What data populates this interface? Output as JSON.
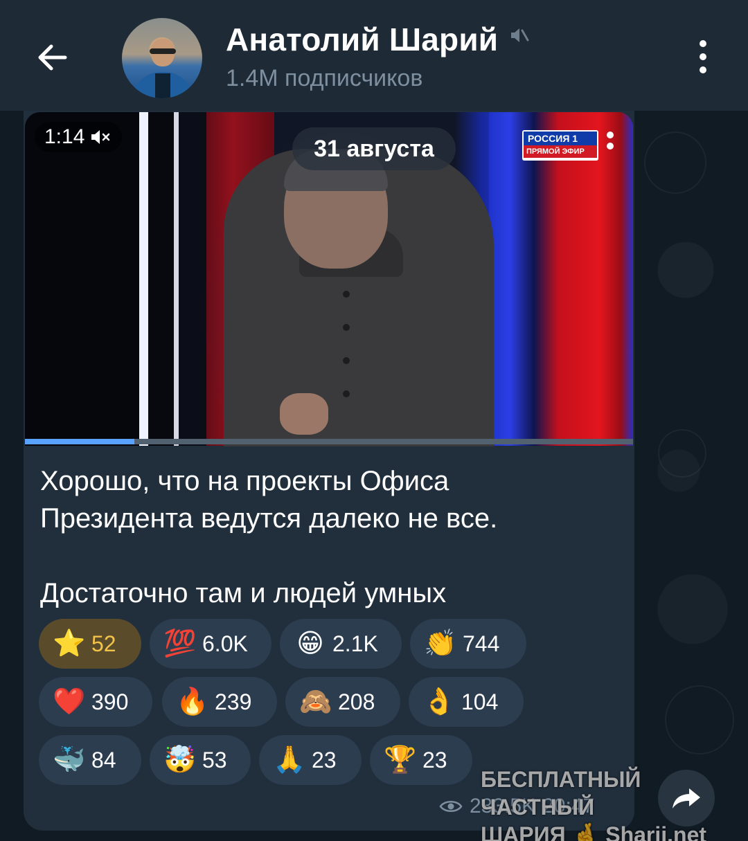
{
  "header": {
    "back_icon": "arrow-left-icon",
    "channel_title": "Анатолий Шарий",
    "muted_icon": "muted-speaker-icon",
    "subscribers": "1.4M подписчиков",
    "menu_icon": "vertical-dots-icon"
  },
  "video": {
    "duration": "1:14",
    "sound_icon": "speaker-muted-icon",
    "date_label": "31 августа",
    "tv_logo_top": "РОССИЯ 1",
    "tv_logo_bottom": "ПРЯМОЙ ЭФИР",
    "progress": 0.18
  },
  "message": {
    "line1": "Хорошо, что на проекты Офиса",
    "line2": "Президента ведутся далеко не все.",
    "line3": "Достаточно там и людей умных"
  },
  "reactions": [
    {
      "emoji": "⭐",
      "count": "52",
      "name": "star"
    },
    {
      "emoji": "💯",
      "count": "6.0K",
      "name": "hundred"
    },
    {
      "emoji": "😁",
      "count": "2.1K",
      "name": "grin"
    },
    {
      "emoji": "👏",
      "count": "744",
      "name": "clap"
    },
    {
      "emoji": "❤️",
      "count": "390",
      "name": "heart"
    },
    {
      "emoji": "🔥",
      "count": "239",
      "name": "fire"
    },
    {
      "emoji": "🙈",
      "count": "208",
      "name": "see-no-evil"
    },
    {
      "emoji": "👌",
      "count": "104",
      "name": "ok-hand"
    },
    {
      "emoji": "🐳",
      "count": "84",
      "name": "whale"
    },
    {
      "emoji": "🤯",
      "count": "53",
      "name": "exploding-head"
    },
    {
      "emoji": "🙏",
      "count": "23",
      "name": "pray"
    },
    {
      "emoji": "🏆",
      "count": "23",
      "name": "trophy"
    }
  ],
  "meta": {
    "views": "233.5K",
    "time": "20:47"
  },
  "watermark": {
    "line1": "БЕСПЛАТНЫЙ ЧАСТНЫЙ",
    "line2": "ШАРИЯ 🤞 Sharij.net"
  },
  "colors": {
    "header_bg": "#1e2a36",
    "bubble_bg": "#212f3d",
    "accent": "#5aa2ff",
    "muted_text": "#7e8f9f",
    "active_reaction": "#f2c24a"
  }
}
